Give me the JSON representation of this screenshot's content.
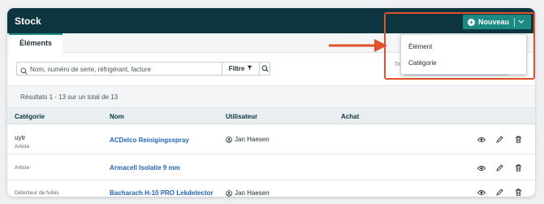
{
  "header": {
    "title": "Stock"
  },
  "new_button": {
    "label": "Nouveau",
    "icon": "plus-circle-icon",
    "chevron": "chevron-down-icon"
  },
  "dropdown": {
    "items": [
      "Élément",
      "Catégorie"
    ]
  },
  "tabs": [
    {
      "label": "Éléments",
      "active": true
    }
  ],
  "search": {
    "placeholder": "Nom, numéro de serie, réfrigérant, facture",
    "filter_label": "Filtre",
    "sort_fragment": "Tri"
  },
  "results": {
    "text": "Résultats 1 - 13 sur un total de 13"
  },
  "table": {
    "columns": [
      "Catégorie",
      "Nom",
      "Utilisateur",
      "Achat"
    ],
    "rows": [
      {
        "category": "uytr",
        "subcategory": "Article",
        "name": "ACDelco Reinigingsspray",
        "user": "Jan Haesen"
      },
      {
        "category": "",
        "subcategory": "Article",
        "name": "Armacell Isolatie 9 mm",
        "user": ""
      },
      {
        "category": "",
        "subcategory": "Détecteur de fuites",
        "name": "Bacharach H-10 PRO Lekdetector",
        "user": "Jan Haesen"
      }
    ]
  },
  "colors": {
    "topbar": "#0d3540",
    "accent": "#1a8a82",
    "link": "#2366b8",
    "annotation": "#e3502d"
  }
}
